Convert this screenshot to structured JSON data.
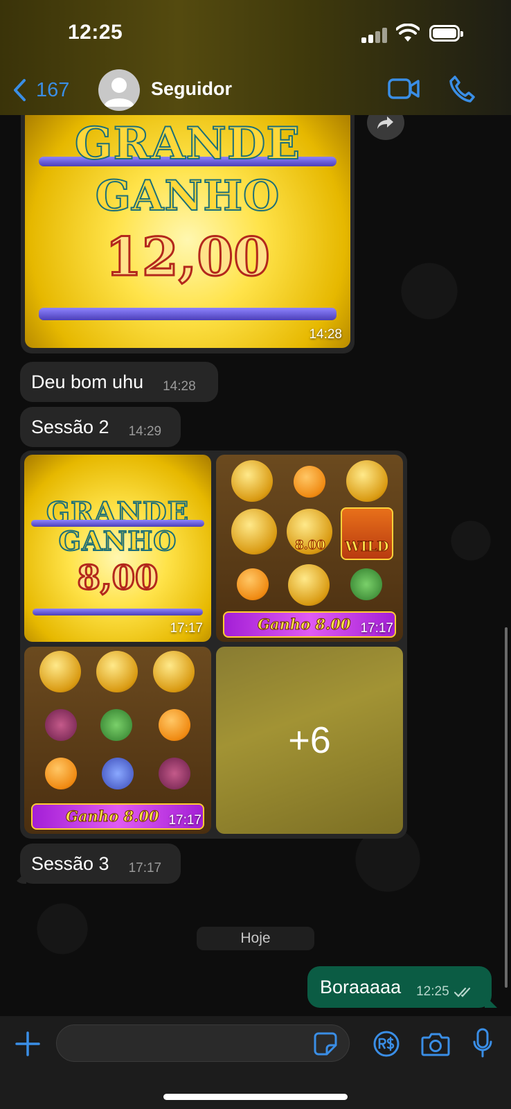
{
  "status_bar": {
    "time": "12:25"
  },
  "header": {
    "back_count": "167",
    "contact_name": "Seguidor"
  },
  "messages": {
    "image1": {
      "title_line1": "GRANDE",
      "title_line2": "GANHO",
      "value": "12,00",
      "time": "14:28"
    },
    "text1": {
      "text": "Deu bom uhu",
      "time": "14:28"
    },
    "text2": {
      "text": "Sessão 2",
      "time": "14:29"
    },
    "album": {
      "tile1": {
        "title_line1": "GRANDE",
        "title_line2": "GANHO",
        "value": "8,00",
        "time": "17:17"
      },
      "tile2": {
        "win_label": "Ganho 8.00",
        "inline_value": "8.00",
        "wild": "WILD",
        "time": "17:17"
      },
      "tile3": {
        "win_label": "Ganho 8.00",
        "time": "17:17"
      },
      "tile4": {
        "more_count": "+6"
      }
    },
    "text3": {
      "text": "Sessão 3",
      "time": "17:17"
    },
    "date_divider": "Hoje",
    "outgoing": {
      "text": "Boraaaaa",
      "time": "12:25"
    }
  },
  "icons": {
    "back": "chevron-left-icon",
    "video": "video-camera-icon",
    "phone": "phone-icon",
    "plus": "plus-icon",
    "sticker": "sticker-icon",
    "pay": "payment-icon",
    "camera": "camera-icon",
    "mic": "microphone-icon"
  },
  "colors": {
    "accent": "#3a8ee6",
    "outgoing_bubble": "#0b5c44",
    "incoming_bubble": "#262626"
  }
}
